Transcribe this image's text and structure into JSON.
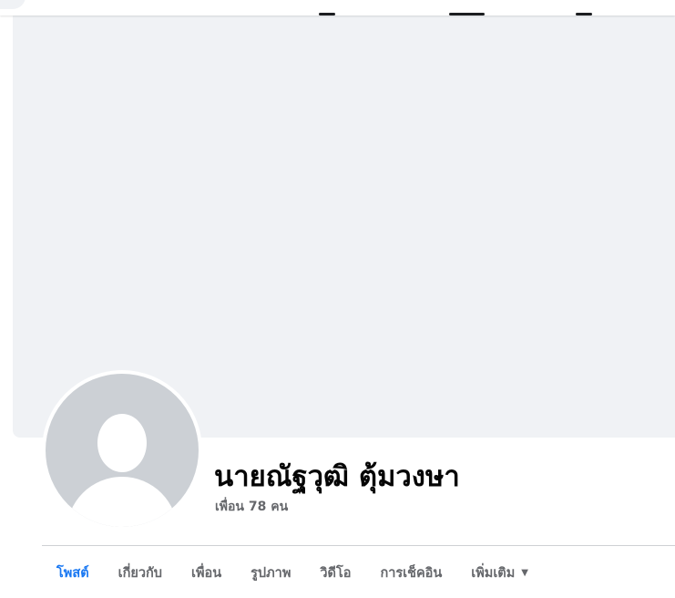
{
  "profile": {
    "name": "นายณัฐวุฒิ ตุ้มวงษา",
    "friends_label": "เพื่อน 78 คน"
  },
  "tabs": [
    {
      "label": "โพสต์",
      "active": true
    },
    {
      "label": "เกี่ยวกับ",
      "active": false
    },
    {
      "label": "เพื่อน",
      "active": false
    },
    {
      "label": "รูปภาพ",
      "active": false
    },
    {
      "label": "วิดีโอ",
      "active": false
    },
    {
      "label": "การเช็คอิน",
      "active": false
    },
    {
      "label": "เพิ่มเติม",
      "active": false,
      "icon": "caret-down-icon"
    }
  ],
  "colors": {
    "accent": "#1877f2",
    "cover": "#f0f2f5",
    "avatar_bg": "#ccd0d5",
    "secondary_text": "#65676b"
  }
}
